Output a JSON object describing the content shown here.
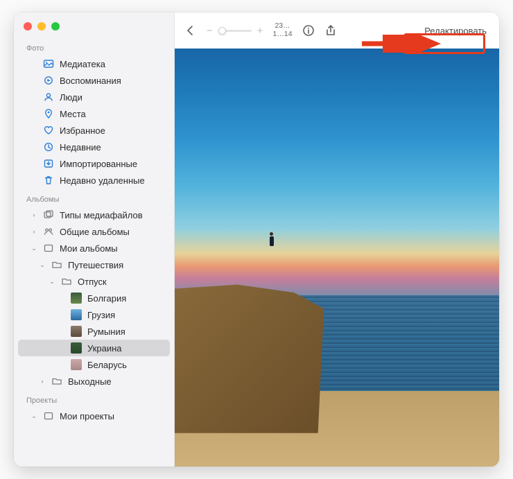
{
  "sidebar": {
    "sections": {
      "photo": {
        "header": "Фото"
      },
      "albums": {
        "header": "Альбомы"
      },
      "projects": {
        "header": "Проекты"
      }
    },
    "photo_items": [
      {
        "label": "Медиатека"
      },
      {
        "label": "Воспоминания"
      },
      {
        "label": "Люди"
      },
      {
        "label": "Места"
      },
      {
        "label": "Избранное"
      },
      {
        "label": "Недавние"
      },
      {
        "label": "Импортированные"
      },
      {
        "label": "Недавно удаленные"
      }
    ],
    "album_items": [
      {
        "label": "Типы медиафайлов"
      },
      {
        "label": "Общие альбомы"
      },
      {
        "label": "Мои альбомы"
      },
      {
        "label": "Путешествия"
      },
      {
        "label": "Отпуск"
      },
      {
        "label": "Болгария"
      },
      {
        "label": "Грузия"
      },
      {
        "label": "Румыния"
      },
      {
        "label": "Украина"
      },
      {
        "label": "Беларусь"
      },
      {
        "label": "Выходные"
      }
    ],
    "project_items": [
      {
        "label": "Мои проекты"
      }
    ]
  },
  "toolbar": {
    "count_top": "23…",
    "count_bottom": "1…14",
    "edit_label": "Редактировать"
  }
}
